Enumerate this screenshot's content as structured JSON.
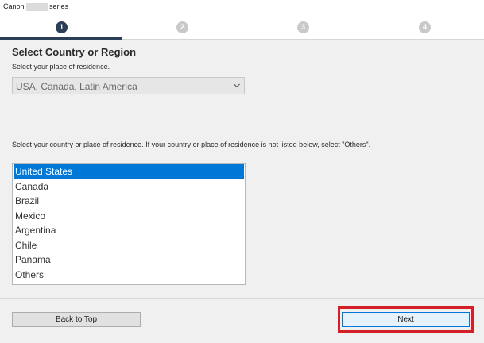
{
  "window": {
    "title_left": "Canon",
    "title_right": "series"
  },
  "steps": [
    {
      "label": "1",
      "state": "active"
    },
    {
      "label": "2",
      "state": "inactive"
    },
    {
      "label": "3",
      "state": "inactive"
    },
    {
      "label": "4",
      "state": "inactive"
    }
  ],
  "main": {
    "heading": "Select Country or Region",
    "subtext": "Select your place of residence.",
    "region_select": {
      "value": "USA, Canada, Latin America"
    },
    "instruction": "Select your country or place of residence. If your country or place of residence is not listed below, select \"Others\".",
    "countries": [
      "United States",
      "Canada",
      "Brazil",
      "Mexico",
      "Argentina",
      "Chile",
      "Panama",
      "Others"
    ],
    "selected_country": "United States"
  },
  "footer": {
    "back_label": "Back to Top",
    "next_label": "Next"
  },
  "colors": {
    "active_step": "#2b3f57",
    "inactive_step": "#c9c9c9",
    "selection": "#0078d7",
    "highlight_box": "#d51f26"
  }
}
